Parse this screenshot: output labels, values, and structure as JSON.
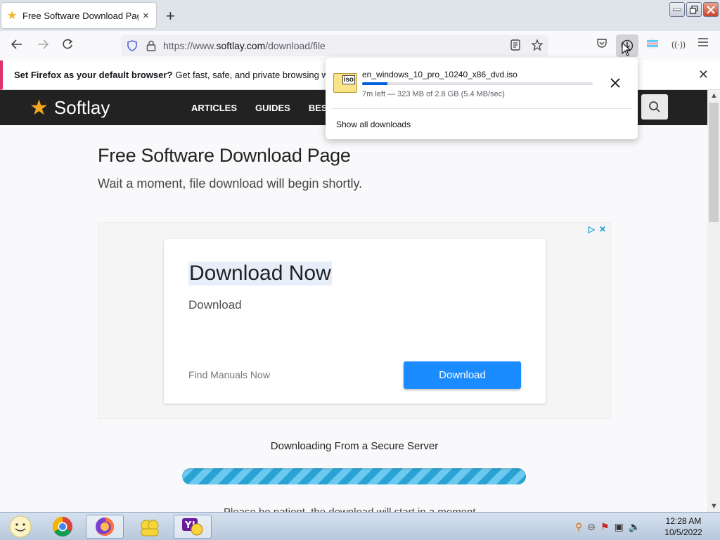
{
  "browser": {
    "tab_title": "Free Software Download Page -",
    "tab_close": "×",
    "new_tab": "+",
    "url_domain_prefix": "https://www.",
    "url_domain": "softlay.com",
    "url_path": "/download/file",
    "window_controls": [
      "minimize",
      "restore",
      "close"
    ]
  },
  "notification": {
    "bold": "Set Firefox as your default browser?",
    "text": "Get fast, safe, and private browsing whenever",
    "close": "✕"
  },
  "site": {
    "logo_text": "Softlay",
    "menu": [
      "ARTICLES",
      "GUIDES",
      "BEST AP"
    ]
  },
  "page": {
    "title": "Free Software Download Page",
    "subtitle": "Wait a moment, file download will begin shortly.",
    "download_heading": "Downloading From a Secure Server",
    "cut_text": "Please be patient, the download will start in a moment..."
  },
  "ad": {
    "headline": "Download Now",
    "description": "Download",
    "domain": "Find Manuals Now",
    "cta": "Download"
  },
  "downloads_panel": {
    "filename": "en_windows_10_pro_10240_x86_dvd.iso",
    "file_badge": "iso",
    "status": "7m left — 323 MB of 2.8 GB (5.4 MB/sec)",
    "progress_fraction": 0.11,
    "show_all": "Show all downloads"
  },
  "taskbar": {
    "time": "12:28 AM",
    "date": "10/5/2022"
  },
  "colors": {
    "accent": "#0061e0",
    "site_header": "#222222",
    "cta": "#1a8cff",
    "notification_stripe": "#e0316f"
  }
}
